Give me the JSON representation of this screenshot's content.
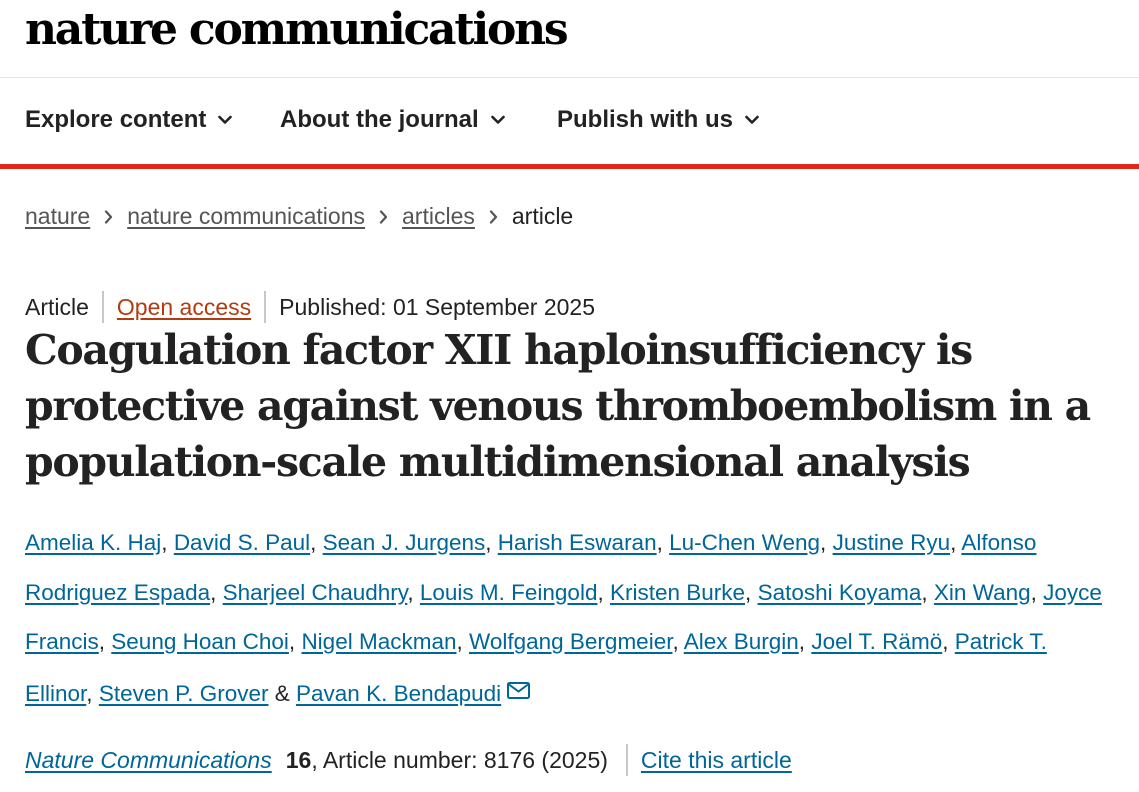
{
  "site": {
    "logo_text": "nature communications"
  },
  "nav": {
    "items": [
      {
        "label": "Explore content",
        "icon": "chevron-down-icon"
      },
      {
        "label": "About the journal",
        "icon": "chevron-down-icon"
      },
      {
        "label": "Publish with us",
        "icon": "chevron-down-icon"
      }
    ],
    "accent_color": "#e0271a"
  },
  "breadcrumb": {
    "items": [
      "nature",
      "nature communications",
      "articles"
    ],
    "current": "article"
  },
  "article": {
    "type": "Article",
    "access": "Open access",
    "published": "Published: 01 September 2025",
    "title": "Coagulation factor XII haploinsufficiency is protective against venous thromboembolism in a population-scale multidimensional analysis",
    "authors": [
      "Amelia K. Haj",
      "David S. Paul",
      "Sean J. Jurgens",
      "Harish Eswaran",
      "Lu-Chen Weng",
      "Justine Ryu",
      "Alfonso Rodriguez Espada",
      "Sharjeel Chaudhry",
      "Louis M. Feingold",
      "Kristen Burke",
      "Satoshi Koyama",
      "Xin Wang",
      "Joyce Francis",
      "Seung Hoan Choi",
      "Nigel Mackman",
      "Wolfgang Bergmeier",
      "Alex Burgin",
      "Joel T. Rämö",
      "Patrick T. Ellinor",
      "Steven P. Grover",
      "Pavan K. Bendapudi"
    ],
    "author_separator": ", ",
    "author_last_separator": " & ",
    "corresponding_icon": "mail-icon",
    "journal": "Nature Communications",
    "volume": "16",
    "article_number": ", Article number: 8176 (2025)",
    "cite_label": "Cite this article"
  },
  "colors": {
    "link": "#006699",
    "open_access": "#b23c12",
    "text": "#222222"
  }
}
